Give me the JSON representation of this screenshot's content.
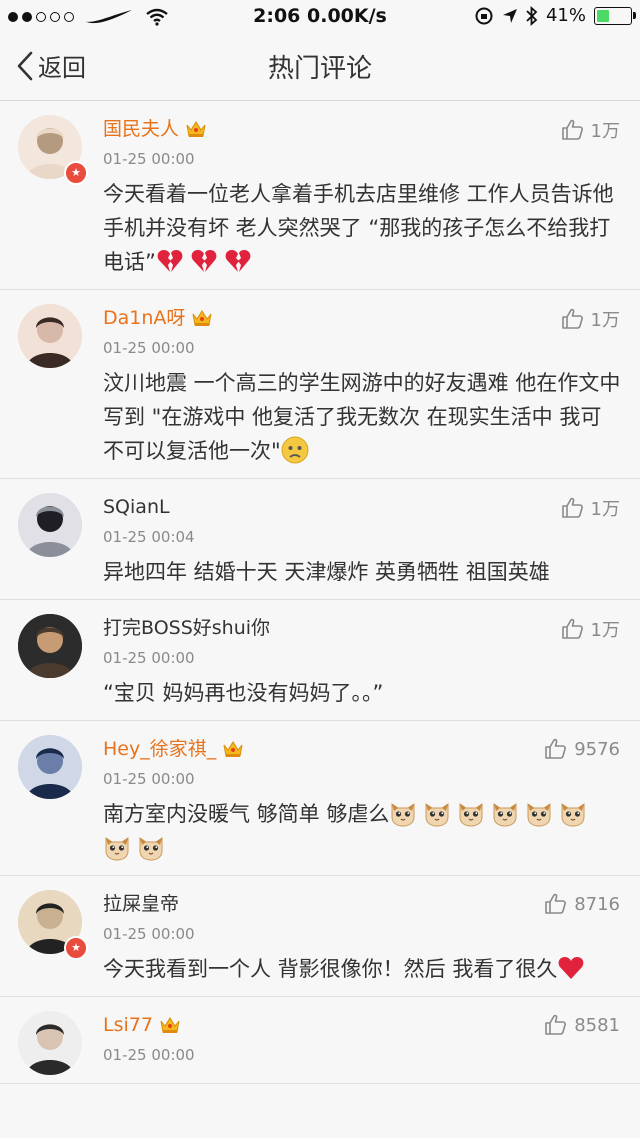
{
  "status": {
    "time": "2:06",
    "speed": "0.00K/s",
    "battery": "41%",
    "battery_level": 0.41
  },
  "nav": {
    "back_label": "返回",
    "title": "热门评论"
  },
  "colors": {
    "vip_name": "#e8731c",
    "text": "#333333",
    "meta": "#8a8a8a"
  },
  "comments": [
    {
      "user": "国民夫人",
      "vip": true,
      "verified": true,
      "time": "01-25 00:00",
      "likes": "1万",
      "text": "今天看着一位老人拿着手机去店里维修 工作人员告诉他手机并没有坏 老人突然哭了 “那我的孩子怎么不给我打电话”",
      "emoji": [
        "broken-heart",
        "broken-heart",
        "broken-heart"
      ]
    },
    {
      "user": "Da1nA呀",
      "vip": true,
      "verified": false,
      "time": "01-25 00:00",
      "likes": "1万",
      "text": "汶川地震 一个高三的学生网游中的好友遇难 他在作文中写到 \"在游戏中 他复活了我无数次 在现实生活中 我可不可以复活他一次\"",
      "emoji": [
        "sad-face"
      ]
    },
    {
      "user": "SQianL",
      "vip": false,
      "verified": false,
      "time": "01-25 00:04",
      "likes": "1万",
      "text": "异地四年   结婚十天   天津爆炸   英勇牺牲   祖国英雄",
      "emoji": []
    },
    {
      "user": "打完BOSS好shui你",
      "vip": false,
      "verified": false,
      "time": "01-25 00:00",
      "likes": "1万",
      "text": "“宝贝   妈妈再也没有妈妈了。。”",
      "emoji": []
    },
    {
      "user": "Hey_徐家祺_",
      "vip": true,
      "verified": false,
      "time": "01-25 00:00",
      "likes": "9576",
      "text": "南方室内没暖气 够简单 够虐么",
      "emoji": [
        "cat-face",
        "cat-face",
        "cat-face",
        "cat-face",
        "cat-face",
        "cat-face",
        "cat-face",
        "cat-face"
      ]
    },
    {
      "user": "拉屎皇帝",
      "vip": false,
      "verified": true,
      "time": "01-25 00:00",
      "likes": "8716",
      "text": "今天我看到一个人 背影很像你！然后 我看了很久",
      "emoji": [
        "red-heart"
      ]
    },
    {
      "user": "Lsi77",
      "vip": true,
      "verified": false,
      "time": "01-25 00:00",
      "likes": "8581",
      "text": "",
      "emoji": []
    }
  ]
}
